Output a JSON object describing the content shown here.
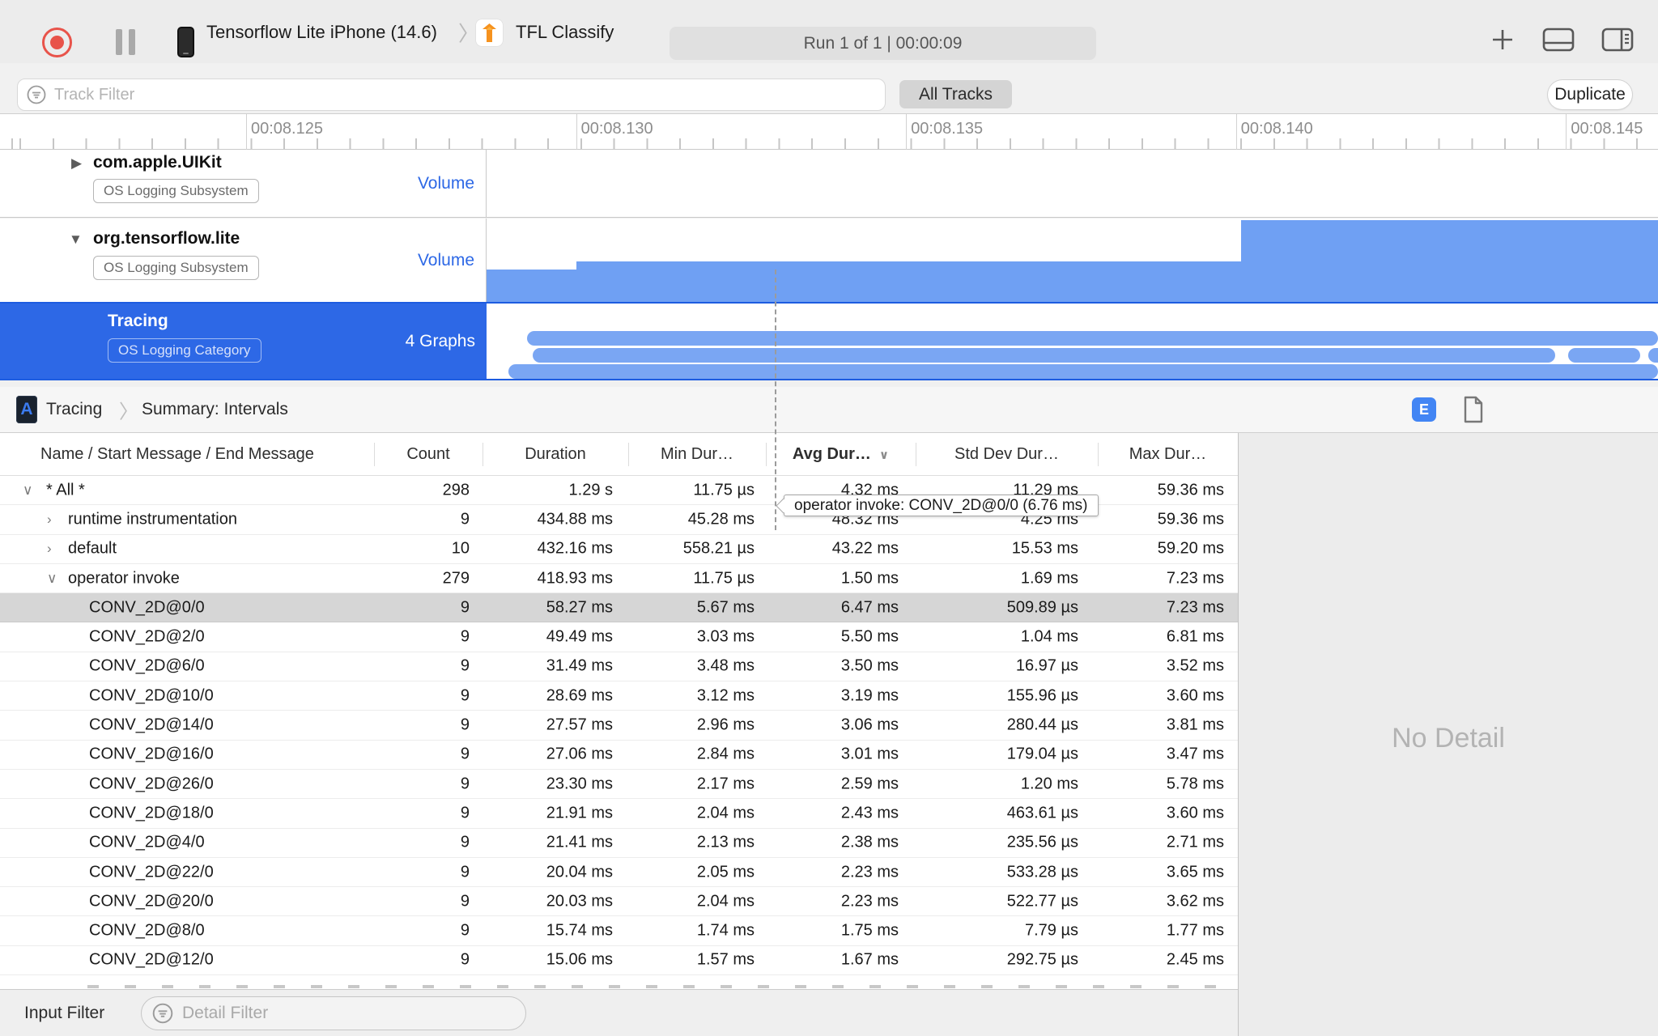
{
  "toolbar": {
    "device_title": "Tensorflow Lite iPhone (14.6)",
    "app_name": "TFL Classify",
    "run_info": "Run 1 of 1  |  00:00:09",
    "track_filter_placeholder": "Track Filter",
    "all_tracks_label": "All Tracks",
    "duplicate_label": "Duplicate"
  },
  "ruler": {
    "labels": [
      "00:08.125",
      "00:08.130",
      "00:08.135",
      "00:08.140",
      "00:08.145"
    ]
  },
  "tracks": [
    {
      "name": "com.apple.UIKit",
      "badge": "OS Logging Subsystem",
      "meta": "Volume"
    },
    {
      "name": "org.tensorflow.lite",
      "badge": "OS Logging Subsystem",
      "meta": "Volume"
    },
    {
      "name": "Tracing",
      "badge": "OS Logging Category",
      "meta": "4 Graphs"
    }
  ],
  "tooltip": {
    "text": "operator invoke: CONV_2D@0/0 (6.76 ms)"
  },
  "detail_header": {
    "breadcrumb_root": "Tracing",
    "breadcrumb_page": "Summary: Intervals",
    "instrument_badge": "A",
    "e_badge": "E"
  },
  "table": {
    "columns": [
      "Name / Start Message / End Message",
      "Count",
      "Duration",
      "Min Dur…",
      "Avg Dur…",
      "Std Dev Dur…",
      "Max Dur…"
    ],
    "sorted_column": "Avg Dur…",
    "rows": [
      {
        "level": 0,
        "chevron": "v",
        "name": "* All *",
        "count": "298",
        "duration": "1.29 s",
        "min": "11.75 µs",
        "avg": "4.32 ms",
        "std": "11.29 ms",
        "max": "59.36 ms",
        "selected": false
      },
      {
        "level": 1,
        "chevron": ">",
        "name": "runtime instrumentation",
        "count": "9",
        "duration": "434.88 ms",
        "min": "45.28 ms",
        "avg": "48.32 ms",
        "std": "4.25 ms",
        "max": "59.36 ms",
        "selected": false
      },
      {
        "level": 1,
        "chevron": ">",
        "name": "default",
        "count": "10",
        "duration": "432.16 ms",
        "min": "558.21 µs",
        "avg": "43.22 ms",
        "std": "15.53 ms",
        "max": "59.20 ms",
        "selected": false
      },
      {
        "level": 1,
        "chevron": "v",
        "name": "operator invoke",
        "count": "279",
        "duration": "418.93 ms",
        "min": "11.75 µs",
        "avg": "1.50 ms",
        "std": "1.69 ms",
        "max": "7.23 ms",
        "selected": false
      },
      {
        "level": 2,
        "chevron": "",
        "name": "CONV_2D@0/0",
        "count": "9",
        "duration": "58.27 ms",
        "min": "5.67 ms",
        "avg": "6.47 ms",
        "std": "509.89 µs",
        "max": "7.23 ms",
        "selected": true
      },
      {
        "level": 2,
        "chevron": "",
        "name": "CONV_2D@2/0",
        "count": "9",
        "duration": "49.49 ms",
        "min": "3.03 ms",
        "avg": "5.50 ms",
        "std": "1.04 ms",
        "max": "6.81 ms",
        "selected": false
      },
      {
        "level": 2,
        "chevron": "",
        "name": "CONV_2D@6/0",
        "count": "9",
        "duration": "31.49 ms",
        "min": "3.48 ms",
        "avg": "3.50 ms",
        "std": "16.97 µs",
        "max": "3.52 ms",
        "selected": false
      },
      {
        "level": 2,
        "chevron": "",
        "name": "CONV_2D@10/0",
        "count": "9",
        "duration": "28.69 ms",
        "min": "3.12 ms",
        "avg": "3.19 ms",
        "std": "155.96 µs",
        "max": "3.60 ms",
        "selected": false
      },
      {
        "level": 2,
        "chevron": "",
        "name": "CONV_2D@14/0",
        "count": "9",
        "duration": "27.57 ms",
        "min": "2.96 ms",
        "avg": "3.06 ms",
        "std": "280.44 µs",
        "max": "3.81 ms",
        "selected": false
      },
      {
        "level": 2,
        "chevron": "",
        "name": "CONV_2D@16/0",
        "count": "9",
        "duration": "27.06 ms",
        "min": "2.84 ms",
        "avg": "3.01 ms",
        "std": "179.04 µs",
        "max": "3.47 ms",
        "selected": false
      },
      {
        "level": 2,
        "chevron": "",
        "name": "CONV_2D@26/0",
        "count": "9",
        "duration": "23.30 ms",
        "min": "2.17 ms",
        "avg": "2.59 ms",
        "std": "1.20 ms",
        "max": "5.78 ms",
        "selected": false
      },
      {
        "level": 2,
        "chevron": "",
        "name": "CONV_2D@18/0",
        "count": "9",
        "duration": "21.91 ms",
        "min": "2.04 ms",
        "avg": "2.43 ms",
        "std": "463.61 µs",
        "max": "3.60 ms",
        "selected": false
      },
      {
        "level": 2,
        "chevron": "",
        "name": "CONV_2D@4/0",
        "count": "9",
        "duration": "21.41 ms",
        "min": "2.13 ms",
        "avg": "2.38 ms",
        "std": "235.56 µs",
        "max": "2.71 ms",
        "selected": false
      },
      {
        "level": 2,
        "chevron": "",
        "name": "CONV_2D@22/0",
        "count": "9",
        "duration": "20.04 ms",
        "min": "2.05 ms",
        "avg": "2.23 ms",
        "std": "533.28 µs",
        "max": "3.65 ms",
        "selected": false
      },
      {
        "level": 2,
        "chevron": "",
        "name": "CONV_2D@20/0",
        "count": "9",
        "duration": "20.03 ms",
        "min": "2.04 ms",
        "avg": "2.23 ms",
        "std": "522.77 µs",
        "max": "3.62 ms",
        "selected": false
      },
      {
        "level": 2,
        "chevron": "",
        "name": "CONV_2D@8/0",
        "count": "9",
        "duration": "15.74 ms",
        "min": "1.74 ms",
        "avg": "1.75 ms",
        "std": "7.79 µs",
        "max": "1.77 ms",
        "selected": false
      },
      {
        "level": 2,
        "chevron": "",
        "name": "CONV_2D@12/0",
        "count": "9",
        "duration": "15.06 ms",
        "min": "1.57 ms",
        "avg": "1.67 ms",
        "std": "292.75 µs",
        "max": "2.45 ms",
        "selected": false
      }
    ]
  },
  "bottom_bar": {
    "label": "Input Filter",
    "detail_filter_placeholder": "Detail Filter"
  },
  "detail_pane": {
    "empty_text": "No Detail"
  },
  "colors": {
    "accent_blue": "#2d68e6",
    "selection_border_blue": "#1d5ce0",
    "volume_bar_blue": "#6fa0f3",
    "lane_bar_blue": "#7aa6f3",
    "selected_row_gray": "#d6d6d6",
    "record_red": "#e8534a",
    "e_badge_blue": "#4285f4"
  }
}
